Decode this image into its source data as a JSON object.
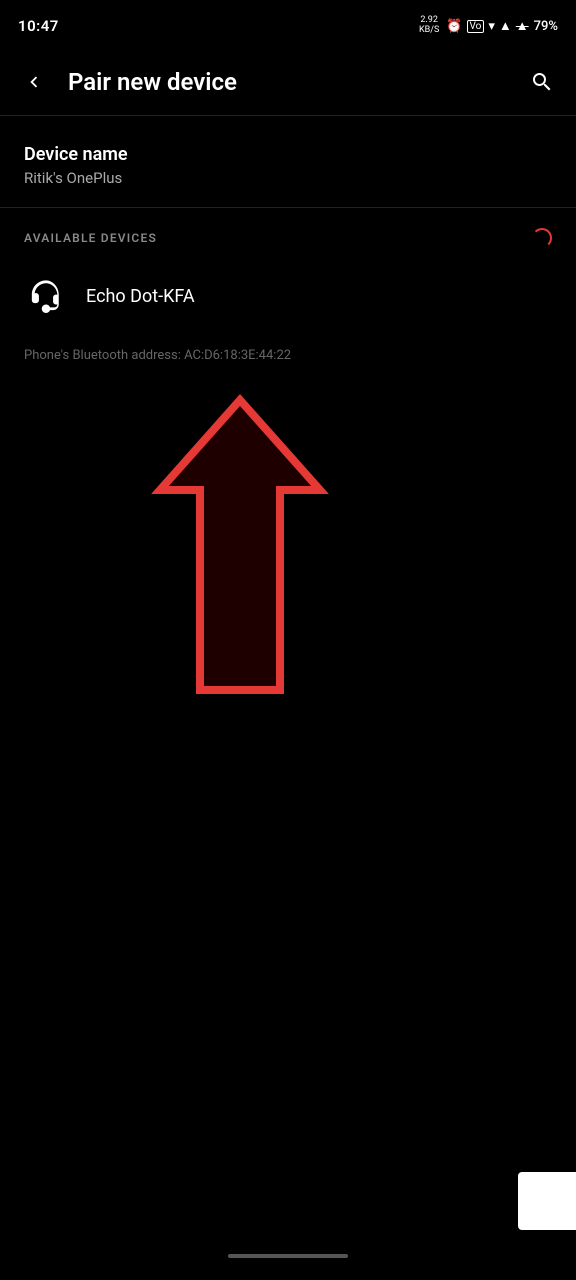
{
  "statusBar": {
    "time": "10:47",
    "speed": "2.92\nKB/S",
    "battery": "79%"
  },
  "appBar": {
    "back_label": "<",
    "title": "Pair new device",
    "search_label": "⌕"
  },
  "deviceName": {
    "label": "Device name",
    "value": "Ritik's OnePlus"
  },
  "availableDevices": {
    "section_label": "AVAILABLE DEVICES",
    "devices": [
      {
        "name": "Echo Dot-KFA",
        "icon": "headphones"
      }
    ]
  },
  "bluetoothAddress": {
    "text": "Phone's Bluetooth address: AC:D6:18:3E:44:22"
  }
}
